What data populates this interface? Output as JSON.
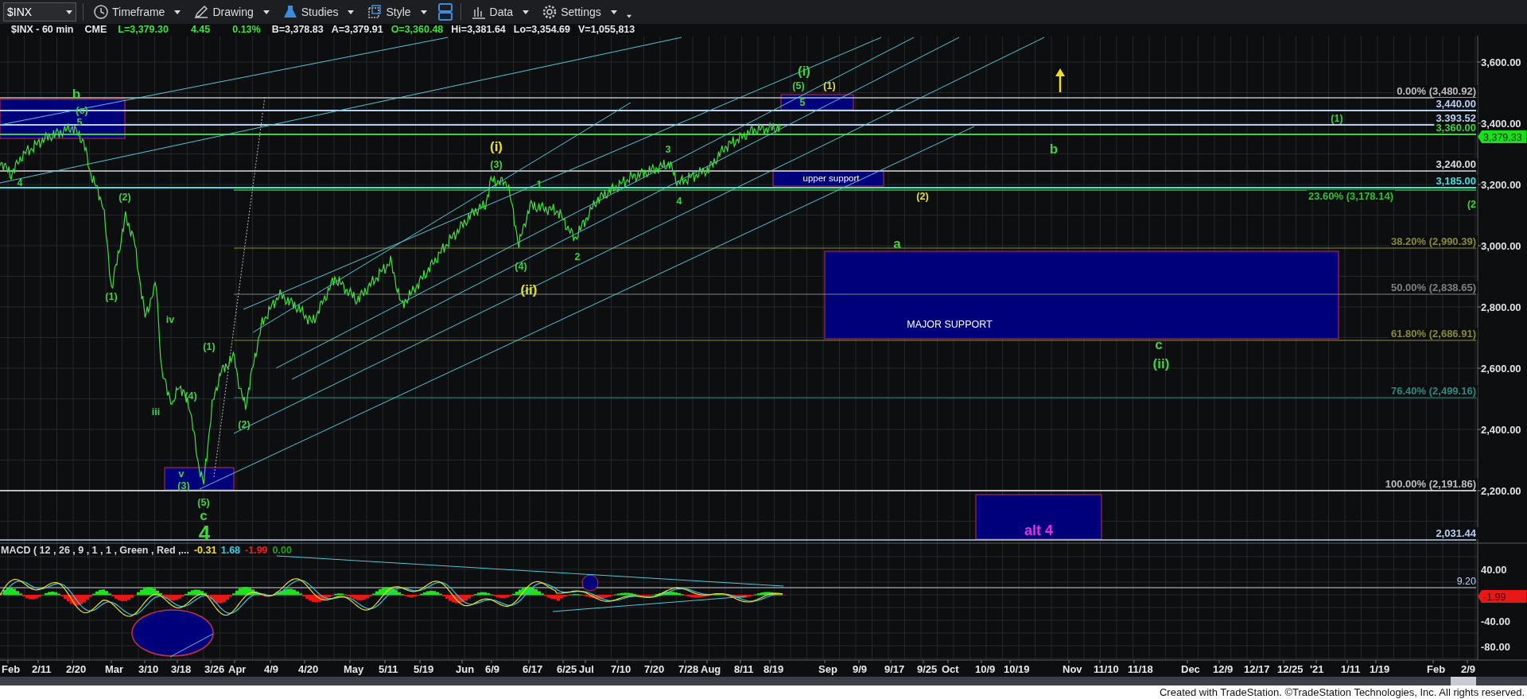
{
  "toolbar": {
    "symbol": "$INX",
    "menus": [
      {
        "label": "Timeframe"
      },
      {
        "label": "Drawing"
      },
      {
        "label": "Studies"
      },
      {
        "label": "Style"
      },
      {
        "label": "Data"
      },
      {
        "label": "Settings"
      }
    ]
  },
  "quote": [
    {
      "text": "$INX - 60 min",
      "color": "#e6e6e6"
    },
    {
      "text": "CME",
      "color": "#e6e6e6"
    },
    {
      "text": "L=3,379.30",
      "color": "#3fe03f"
    },
    {
      "text": "4.45",
      "color": "#3fe03f"
    },
    {
      "text": "0.13%",
      "color": "#3fe03f"
    },
    {
      "text": "B=3,378.83",
      "color": "#e6e6e6"
    },
    {
      "text": "A=3,379.91",
      "color": "#e6e6e6"
    },
    {
      "text": "O=3,360.48",
      "color": "#3fe03f"
    },
    {
      "text": "Hi=3,381.64",
      "color": "#e6e6e6"
    },
    {
      "text": "Lo=3,354.69",
      "color": "#e6e6e6"
    },
    {
      "text": "V=1,055,813",
      "color": "#e6e6e6"
    }
  ],
  "price_axis": {
    "ticks": [
      "3,600.00",
      "3,400.00",
      "3,200.00",
      "3,000.00",
      "2,800.00",
      "2,600.00",
      "2,400.00",
      "2,200.00"
    ],
    "last_price": "3,379.33"
  },
  "levels": [
    {
      "label": "0.00% (3,480.92)",
      "color": "#bdbdbd"
    },
    {
      "label": "3,440.00",
      "color": "#b8d0f0"
    },
    {
      "label": "3,393.52",
      "color": "#b8d0f0"
    },
    {
      "label": "3,360.00",
      "color": "#3fd33f"
    },
    {
      "label": "3,240.00",
      "color": "#dcdcdc"
    },
    {
      "label": "3,185.00",
      "color": "#40e0e0"
    },
    {
      "label": "23.60% (3,178.14)",
      "color": "#30c030"
    },
    {
      "label": "38.20% (2,990.39)",
      "color": "#8a8a30"
    },
    {
      "label": "50.00% (2,838.65)",
      "color": "#808080"
    },
    {
      "label": "61.80% (2,686.91)",
      "color": "#8a8a30"
    },
    {
      "label": "76.40% (2,499.16)",
      "color": "#2a8a80"
    },
    {
      "label": "100.00% (2,191.86)",
      "color": "#bdbdbd"
    },
    {
      "label": "2,031.44",
      "color": "#b8d0f0"
    }
  ],
  "zones": [
    {
      "label": "upper support",
      "color": "#ffffff"
    },
    {
      "label": "MAJOR SUPPORT",
      "color": "#ffffff"
    },
    {
      "label": "alt 4",
      "color": "#e030e0"
    }
  ],
  "annotations": [
    {
      "text": "b",
      "kind": "major",
      "color": "#3fd33f"
    },
    {
      "text": "(c)",
      "kind": "minor",
      "color": "#3fd33f"
    },
    {
      "text": "5",
      "kind": "minor",
      "color": "#3fd33f"
    },
    {
      "text": "4",
      "kind": "minor",
      "color": "#3fd33f"
    },
    {
      "text": "(2)",
      "kind": "minor",
      "color": "#3fd33f"
    },
    {
      "text": "(1)",
      "kind": "minor",
      "color": "#3fd33f"
    },
    {
      "text": "iv",
      "kind": "minor",
      "color": "#3fd33f"
    },
    {
      "text": "iii",
      "kind": "minor",
      "color": "#3fd33f"
    },
    {
      "text": "(1)",
      "kind": "minor",
      "color": "#3fd33f"
    },
    {
      "text": "(4)",
      "kind": "minor",
      "color": "#3fd33f"
    },
    {
      "text": "(2)",
      "kind": "minor",
      "color": "#3fd33f"
    },
    {
      "text": "v",
      "kind": "minor",
      "color": "#3fd33f"
    },
    {
      "text": "(3)",
      "kind": "minor",
      "color": "#3fd33f"
    },
    {
      "text": "(5)",
      "kind": "minor",
      "color": "#3fd33f"
    },
    {
      "text": "c",
      "kind": "major",
      "color": "#3fd33f"
    },
    {
      "text": "4",
      "kind": "large",
      "color": "#3fd33f"
    },
    {
      "text": "(i)",
      "kind": "major",
      "color": "#e8e020"
    },
    {
      "text": "(3)",
      "kind": "minor",
      "color": "#3fd33f"
    },
    {
      "text": "1",
      "kind": "minor",
      "color": "#3fd33f"
    },
    {
      "text": "(4)",
      "kind": "minor",
      "color": "#3fd33f"
    },
    {
      "text": "2",
      "kind": "minor",
      "color": "#3fd33f"
    },
    {
      "text": "(ii)",
      "kind": "major",
      "color": "#e8e020"
    },
    {
      "text": "3",
      "kind": "minor",
      "color": "#3fd33f"
    },
    {
      "text": "4",
      "kind": "minor",
      "color": "#3fd33f"
    },
    {
      "text": "(i)",
      "kind": "major",
      "color": "#3fd33f"
    },
    {
      "text": "(5)",
      "kind": "minor",
      "color": "#3fd33f"
    },
    {
      "text": "(1)",
      "kind": "minor",
      "color": "#e8e020"
    },
    {
      "text": "5",
      "kind": "minor",
      "color": "#3fd33f"
    },
    {
      "text": "b",
      "kind": "major",
      "color": "#3fd33f"
    },
    {
      "text": "(1)",
      "kind": "minor",
      "color": "#3fd33f"
    },
    {
      "text": "(2)",
      "kind": "minor",
      "color": "#e8e020"
    },
    {
      "text": "(2",
      "kind": "minor",
      "color": "#3fd33f"
    },
    {
      "text": "a",
      "kind": "major",
      "color": "#3fd33f"
    },
    {
      "text": "c",
      "kind": "major",
      "color": "#3fd33f"
    },
    {
      "text": "(ii)",
      "kind": "major",
      "color": "#3fd33f"
    }
  ],
  "macd": {
    "title": "MACD ( 12 , 26 , 9 , 1 , 1 , Green , Red ,...",
    "values": [
      {
        "text": "-0.31",
        "color": "#f0e020"
      },
      {
        "text": "1.68",
        "color": "#30d0e8"
      },
      {
        "text": "-1.99",
        "color": "#e82020"
      },
      {
        "text": "0.00",
        "color": "#20a020"
      }
    ],
    "ticks": [
      "40.00",
      "-40.00",
      "-80.00"
    ],
    "level_label": "9.20",
    "last_value": "-1.99"
  },
  "date_axis": [
    "Feb",
    "2/11",
    "2/20",
    "Mar",
    "3/10",
    "3/18",
    "3/26",
    "Apr",
    "4/9",
    "4/20",
    "May",
    "5/11",
    "5/19",
    "Jun",
    "6/9",
    "6/17",
    "6/25",
    "Jul",
    "7/10",
    "7/20",
    "7/28",
    "Aug",
    "8/11",
    "8/19",
    "Sep",
    "9/9",
    "9/17",
    "9/25",
    "Oct",
    "10/9",
    "10/19",
    "Nov",
    "11/10",
    "11/18",
    "Dec",
    "12/9",
    "12/17",
    "12/25",
    "'21",
    "1/11",
    "1/19",
    "Feb",
    "2/9"
  ],
  "footer": "Created with TradeStation. ©TradeStation Technologies, Inc. All rights reserved."
}
